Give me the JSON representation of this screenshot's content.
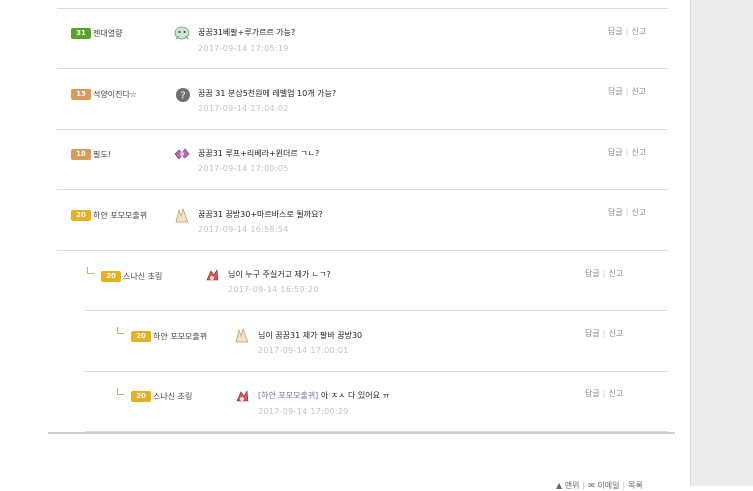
{
  "comments": [
    {
      "level": "31",
      "nick": "젠대열량",
      "text": "꿈꿈31베팔+루가르르 가능?",
      "date": "2017-09-14 17:05:19",
      "reply_label": "답글",
      "report_label": "신고"
    },
    {
      "level": "13",
      "nick": "석양이진다☆",
      "text": "꿈꿈 31 분상5천원에 레벨업 10개 가능?",
      "date": "2017-09-14 17:04:02",
      "reply_label": "답글",
      "report_label": "신고"
    },
    {
      "level": "18",
      "nick": "필도!",
      "text": "꿈꿈31 루프+리베라+윈더르 ㄱㄴ?",
      "date": "2017-09-14 17:00:05",
      "reply_label": "답글",
      "report_label": "신고"
    },
    {
      "level": "20",
      "nick": "하얀 포모모출뀌",
      "text": "꿈꿈31 꿈방30+마르바스로 될까요?",
      "date": "2017-09-14 16:58:54",
      "reply_label": "답글",
      "report_label": "신고"
    },
    {
      "level": "20",
      "nick": "스나신 초링",
      "text": "님이 누구 주실거고 제가 ㄴㄱ?",
      "date": "2017-09-14 16:59:20",
      "reply_label": "답글",
      "report_label": "신고"
    },
    {
      "level": "20",
      "nick": "하얀 포모모출뀌",
      "text": "님이 꿈꿈31 제가 팔바 꿈방30",
      "date": "2017-09-14 17:00:01",
      "reply_label": "답글",
      "report_label": "신고"
    },
    {
      "level": "20",
      "nick": "스나신 초링",
      "tag": "[하얀 포모모출뀌]",
      "text": "아 ㅈㅅ 다 있어요 ㅠ",
      "date": "2017-09-14 17:00:29",
      "reply_label": "답글",
      "report_label": "신고"
    }
  ],
  "footer": {
    "items": [
      "▲ 맨위",
      "✉ 이메일",
      "목록"
    ]
  },
  "colors": {
    "level_green": "#5aa32a",
    "level_orange": "#d99b58",
    "level_yellow": "#e8b021",
    "date": "#c3c3c3",
    "reply_mark": "#e3b034"
  }
}
